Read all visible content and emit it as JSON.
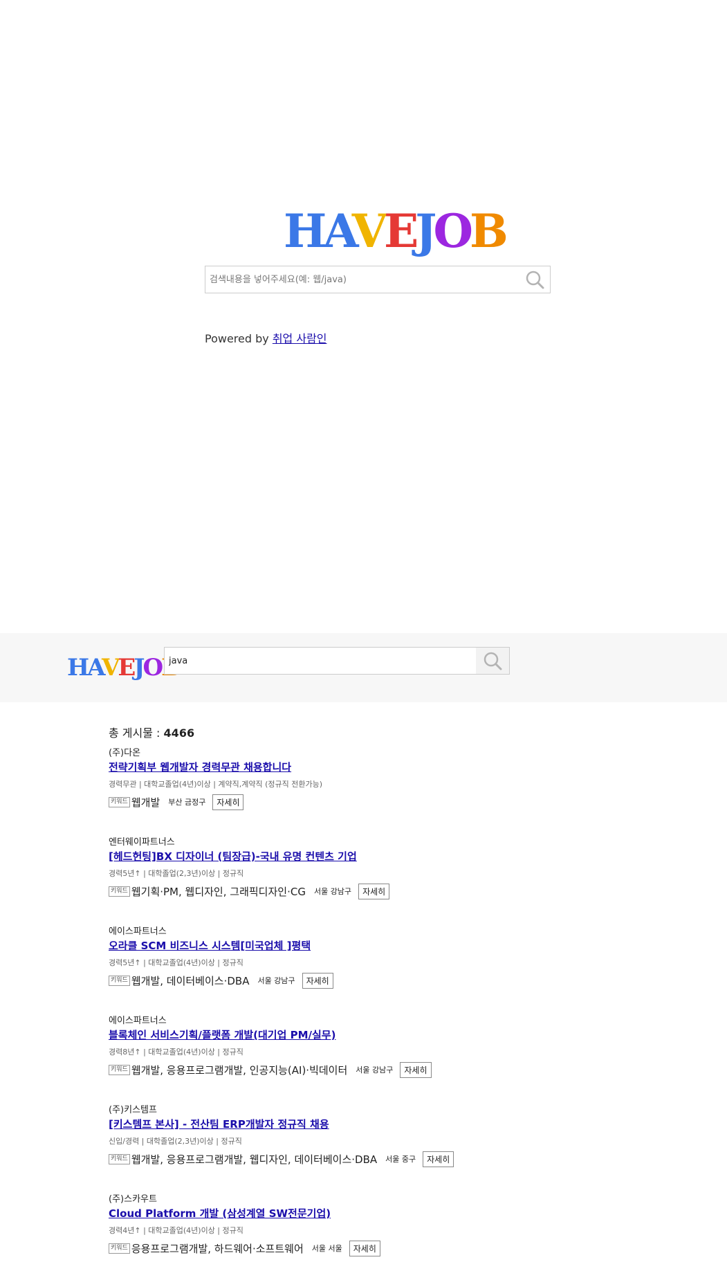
{
  "landing": {
    "logo": {
      "letters": [
        "H",
        "A",
        "V",
        "E",
        "J",
        "O",
        "B"
      ],
      "colors": [
        "#3b78e7",
        "#3b78e7",
        "#f0b400",
        "#e53935",
        "#3b78e7",
        "#9c27e0",
        "#f08a00"
      ]
    },
    "search": {
      "placeholder": "검색내용을 넣어주세요(예: 웹/java)",
      "value": ""
    },
    "powered_prefix": "Powered by",
    "powered_link": "취업 사람인"
  },
  "header": {
    "logo": {
      "letters": [
        "H",
        "A",
        "V",
        "E",
        "J",
        "O",
        "B"
      ]
    },
    "search": {
      "value": "java"
    }
  },
  "results": {
    "total_label": "총 게시물 :",
    "total_count": "4466",
    "keyword_badge": "키워드",
    "detail_label": "자세히",
    "items": [
      {
        "company": "(주)다온",
        "title": "전략기획부 웹개발자 경력무관 채용합니다",
        "meta": "경력무관 | 대학교졸업(4년)이상 | 계약직,계약직 (정규직 전환가능)",
        "keywords": "웹개발",
        "location": "부산 금정구"
      },
      {
        "company": "엔터웨이파트너스",
        "title": "[헤드헌팅]BX 디자이너 (팀장급)-국내 유명 컨텐츠 기업",
        "meta": "경력5년↑ | 대학졸업(2,3년)이상 | 정규직",
        "keywords": "웹기획·PM, 웹디자인, 그래픽디자인·CG",
        "location": "서울 강남구"
      },
      {
        "company": "에이스파트너스",
        "title": "오라클 SCM 비즈니스 시스템[미국업체 ]평택",
        "meta": "경력5년↑ | 대학교졸업(4년)이상 | 정규직",
        "keywords": "웹개발, 데이터베이스·DBA",
        "location": "서울 강남구"
      },
      {
        "company": "에이스파트너스",
        "title": "블록체인 서비스기획/플랫폼 개발(대기업 PM/실무)",
        "meta": "경력8년↑ | 대학교졸업(4년)이상 | 정규직",
        "keywords": "웹개발, 응용프로그램개발, 인공지능(AI)·빅데이터",
        "location": "서울 강남구"
      },
      {
        "company": "(주)키스템프",
        "title": "[키스템프 본사] - 전산팀 ERP개발자 정규직 채용",
        "meta": "신입/경력 | 대학졸업(2,3년)이상 | 정규직",
        "keywords": "웹개발, 응용프로그램개발, 웹디자인, 데이터베이스·DBA",
        "location": "서울 중구"
      },
      {
        "company": "(주)스카우트",
        "title": "Cloud Platform 개발 (삼성계열 SW전문기업)",
        "meta": "경력4년↑ | 대학교졸업(4년)이상 | 정규직",
        "keywords": "응용프로그램개발, 하드웨어·소프트웨어",
        "location": "서울 서울"
      }
    ]
  }
}
